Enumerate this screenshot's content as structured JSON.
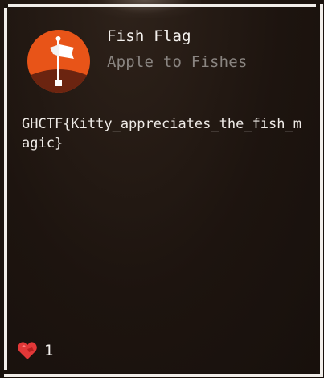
{
  "challenge": {
    "title": "Fish Flag",
    "subtitle": "Apple to Fishes",
    "flag": "GHCTF{Kitty_appreciates_the_fish_magic}",
    "badge_icon": "flag-on-hill-icon",
    "badge_color": "#e85418"
  },
  "footer": {
    "icon": "red-heart-icon",
    "count": "1",
    "icon_color": "#e23838"
  }
}
